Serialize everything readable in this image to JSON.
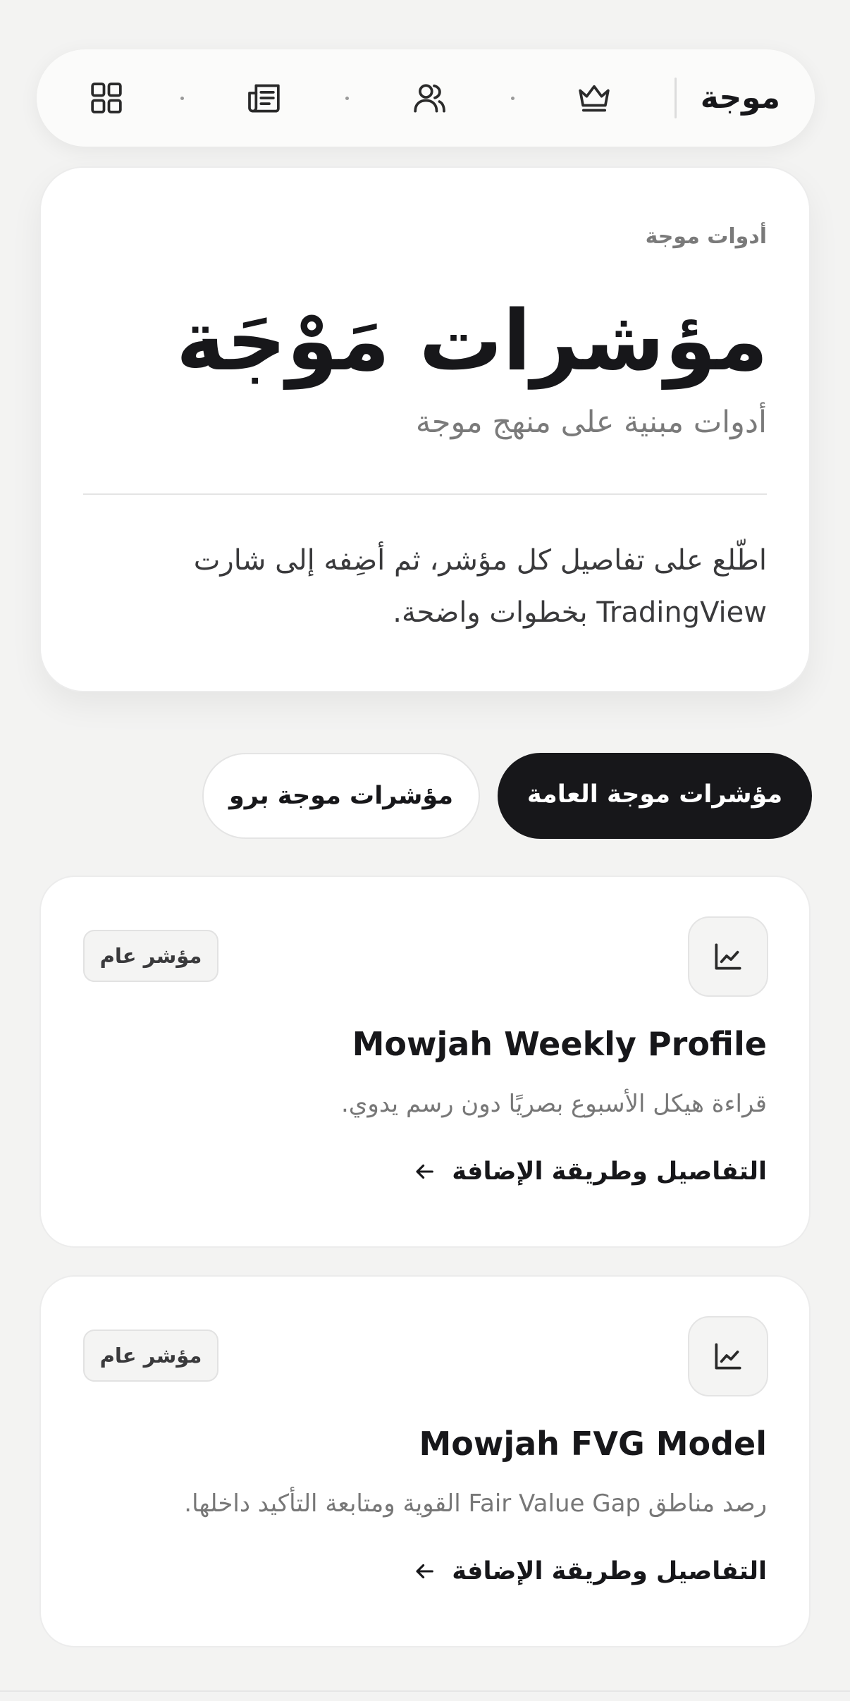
{
  "nav": {
    "brand": "موجة",
    "icons": [
      "crown-icon",
      "users-icon",
      "newspaper-icon",
      "grid-icon"
    ]
  },
  "hero": {
    "eyebrow": "أدوات موجة",
    "title": "مؤشرات مَوْجَة",
    "subtitle": "أدوات مبنية على منهج موجة",
    "description": "اطّلع على تفاصيل كل مؤشر، ثم أضِفه إلى شارت TradingView بخطوات واضحة."
  },
  "tabs": [
    {
      "label": "مؤشرات موجة العامة",
      "active": true
    },
    {
      "label": "مؤشرات موجة برو",
      "active": false
    }
  ],
  "indicators": [
    {
      "badge": "مؤشر عام",
      "name": "Mowjah Weekly Profile",
      "summary": "قراءة هيكل الأسبوع بصريًا دون رسم يدوي.",
      "link": "التفاصيل وطريقة الإضافة",
      "icon": "chart-line-icon"
    },
    {
      "badge": "مؤشر عام",
      "name": "Mowjah FVG Model",
      "summary": "رصد مناطق Fair Value Gap القوية ومتابعة التأكيد داخلها.",
      "link": "التفاصيل وطريقة الإضافة",
      "icon": "chart-line-icon"
    }
  ],
  "colors": {
    "background": "#f3f3f2",
    "surface": "#ffffff",
    "ink": "#17171a",
    "muted": "#7a7a7a",
    "border": "#e4e4e4"
  }
}
